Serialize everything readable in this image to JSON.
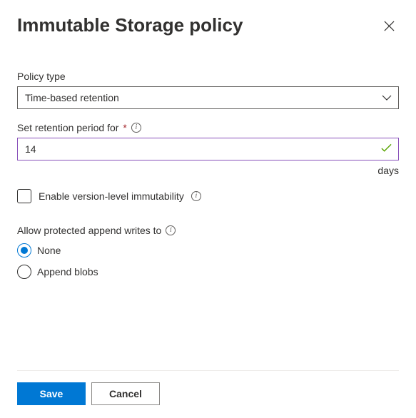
{
  "dialog": {
    "title": "Immutable Storage policy"
  },
  "policyType": {
    "label": "Policy type",
    "value": "Time-based retention"
  },
  "retentionPeriod": {
    "label": "Set retention period for",
    "value": "14",
    "unit": "days"
  },
  "versionLevel": {
    "label": "Enable version-level immutability",
    "checked": false
  },
  "appendWrites": {
    "label": "Allow protected append writes to",
    "options": [
      {
        "label": "None",
        "selected": true
      },
      {
        "label": "Append blobs",
        "selected": false
      }
    ]
  },
  "footer": {
    "save": "Save",
    "cancel": "Cancel"
  }
}
